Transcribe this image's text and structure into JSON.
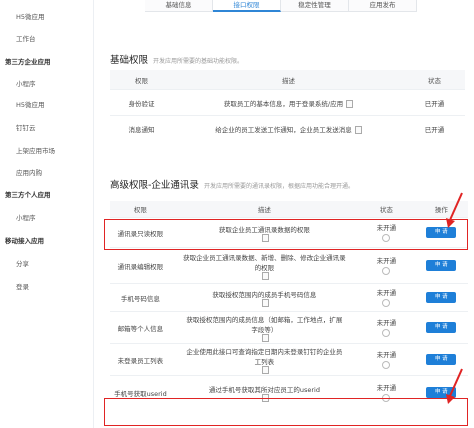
{
  "sidebar": {
    "items": [
      {
        "label": "H5微应用",
        "kind": "sub"
      },
      {
        "label": "工作台",
        "kind": "sub"
      },
      {
        "label": "第三方企业应用",
        "kind": "group"
      },
      {
        "label": "小程序",
        "kind": "sub"
      },
      {
        "label": "H5微应用",
        "kind": "sub"
      },
      {
        "label": "钉钉云",
        "kind": "sub"
      },
      {
        "label": "上架应用市场",
        "kind": "sub"
      },
      {
        "label": "应用内购",
        "kind": "sub"
      },
      {
        "label": "第三方个人应用",
        "kind": "group"
      },
      {
        "label": "小程序",
        "kind": "sub"
      },
      {
        "label": "移动接入应用",
        "kind": "group"
      },
      {
        "label": "分享",
        "kind": "sub"
      },
      {
        "label": "登录",
        "kind": "sub"
      }
    ]
  },
  "tabs": [
    {
      "label": "基础信息",
      "active": false
    },
    {
      "label": "接口权限",
      "active": true
    },
    {
      "label": "稳定性管理",
      "active": false
    },
    {
      "label": "应用发布",
      "active": false
    }
  ],
  "basic": {
    "title": "基础权限",
    "subtitle": "开发应用所需要的基础功能权限。",
    "headers": [
      "权限",
      "描述",
      "状态"
    ],
    "rows": [
      {
        "name": "身份验证",
        "desc": "获取员工的基本信息，用于登录系统/应用",
        "status": "已开通"
      },
      {
        "name": "消息通知",
        "desc": "给企业的员工发送工作通知，企业员工发送消息",
        "status": "已开通"
      }
    ]
  },
  "advanced": {
    "title": "高级权限-企业通讯录",
    "subtitle": "开发应用所需要的通讯录权限，根据应用功能合理开通。",
    "headers": [
      "权限",
      "描述",
      "状态",
      "操作"
    ],
    "apply_label": "申 请",
    "rows": [
      {
        "name": "通讯录只读权限",
        "desc": [
          "获取企业员工通讯录数据的权限"
        ],
        "status": "未开通",
        "highlight": true
      },
      {
        "name": "通讯录编辑权限",
        "desc": [
          "获取企业员工通讯录数据、新增、删除、修改企业通讯录",
          "的权限"
        ],
        "status": "未开通",
        "highlight": false
      },
      {
        "name": "手机号码信息",
        "desc": [
          "获取授权范围内的成员手机号码信息"
        ],
        "status": "未开通",
        "highlight": false
      },
      {
        "name": "邮箱等个人信息",
        "desc": [
          "获取授权范围内的成员信息（如邮箱，工作地点，扩展",
          "字段等）"
        ],
        "status": "未开通",
        "highlight": false
      },
      {
        "name": "未登录员工列表",
        "desc": [
          "企业使用此接口可查询指定日期内未登录钉钉的企业员",
          "工列表"
        ],
        "status": "未开通",
        "highlight": false
      },
      {
        "name": "手机号获取userid",
        "desc": [
          "通过手机号获取其所对应员工的userid"
        ],
        "status": "未开通",
        "highlight": true
      }
    ]
  },
  "colors": {
    "accent": "#1e7fd8",
    "highlight": "#e02424"
  }
}
